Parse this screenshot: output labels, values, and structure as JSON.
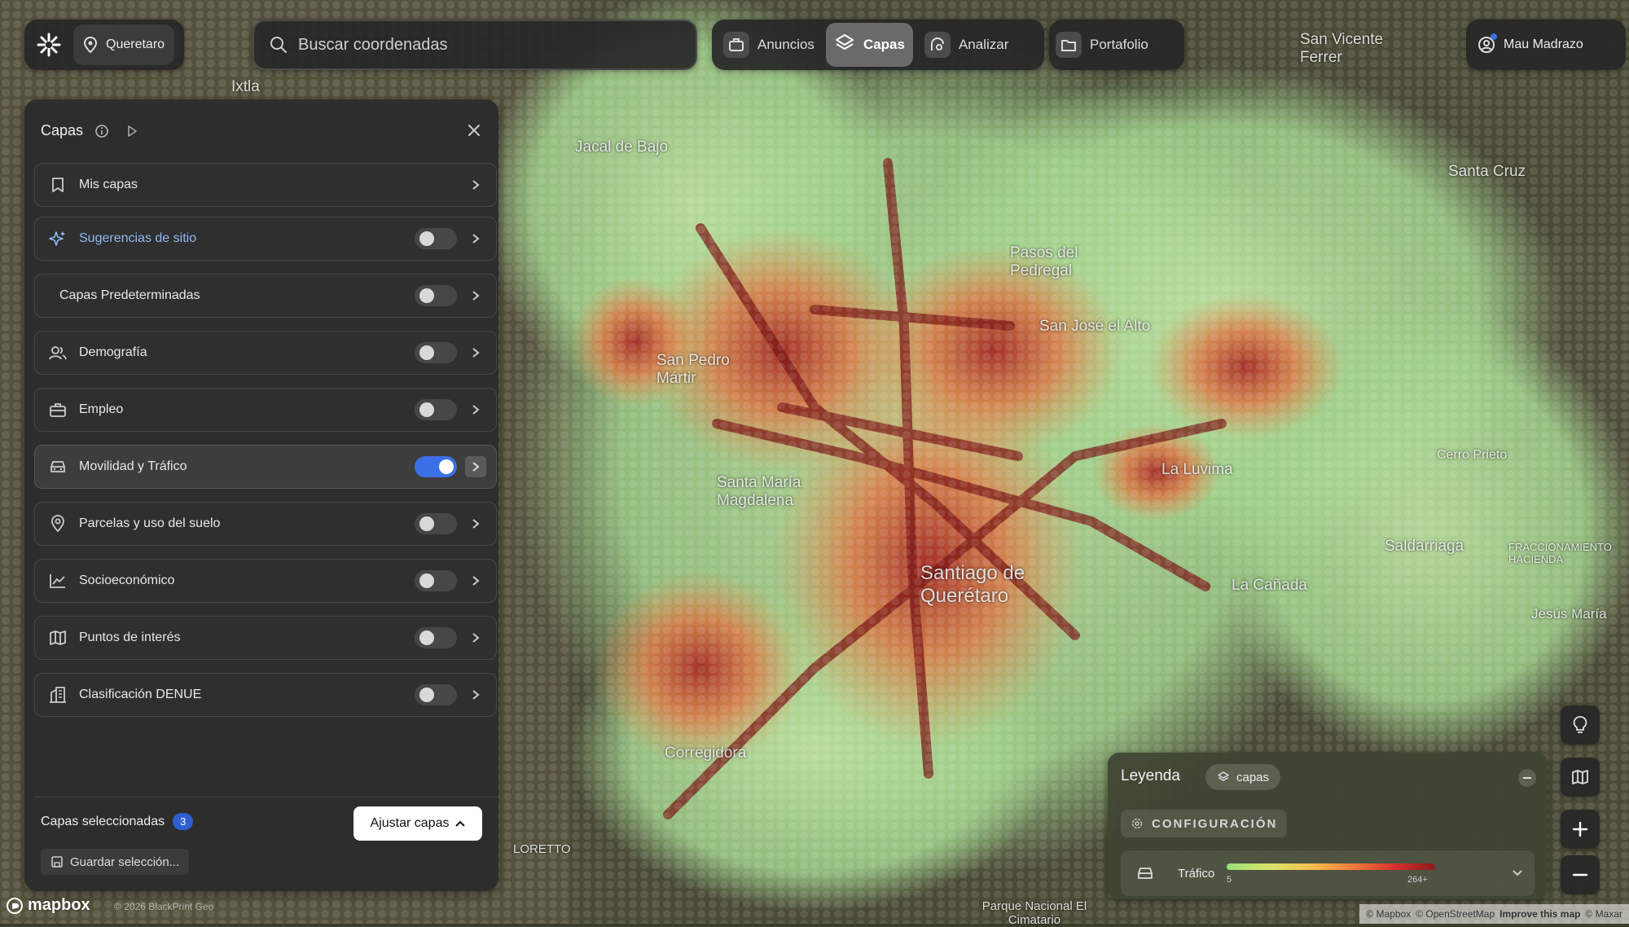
{
  "header": {
    "location": "Queretaro",
    "search_placeholder": "Buscar coordenadas",
    "nav": [
      "Anuncios",
      "Capas",
      "Analizar"
    ],
    "portfolio": "Portafolio",
    "user": "Mau Madrazo"
  },
  "panel": {
    "title": "Capas",
    "rows": [
      {
        "label": "Mis capas",
        "icon": "bookmark-icon"
      },
      {
        "label": "Sugerencias de sitio",
        "icon": "sparkle-icon"
      },
      {
        "label": "Capas Predeterminadas",
        "icon": ""
      },
      {
        "label": "Demografía",
        "icon": "users-icon"
      },
      {
        "label": "Empleo",
        "icon": "briefcase-icon"
      },
      {
        "label": "Movilidad y Tráfico",
        "icon": "car-icon"
      },
      {
        "label": "Parcelas y uso del suelo",
        "icon": "pin-icon"
      },
      {
        "label": "Socioeconómico",
        "icon": "chart-line-icon"
      },
      {
        "label": "Puntos de interés",
        "icon": "map-icon"
      },
      {
        "label": "Clasificación DENUE",
        "icon": "building-icon"
      }
    ],
    "selected_label": "Capas seleccionadas",
    "selected_count": "3",
    "adjust_label": "Ajustar capas",
    "save_label": "Guardar selección..."
  },
  "legend": {
    "title": "Leyenda",
    "chip": "capas",
    "config": "CONFIGURACIÓN",
    "layer": "Tráfico",
    "min": "5",
    "max": "264+"
  },
  "map_labels": {
    "ixtla": "Ixtla",
    "jacal": "Jacal de Bajo",
    "pasos": "Pasos del Pedregal",
    "sanjose": "San José el Alto",
    "sanvicente": "San Vicente Ferrer",
    "santacruz": "Santa Cruz",
    "sanpedro": "San Pedro Mártir",
    "santamaria": "Santa María Magdalena",
    "lauvima": "La Luvima",
    "santiago": "Santiago de Querétaro",
    "lacanada": "La Cañada",
    "saldarriaga": "Saldarriaga",
    "corregidora": "Corregidora",
    "loretto": "LORETTO",
    "parque": "Parque Nacional El Cimatario",
    "cerro": "Cerro Prieto",
    "jesusmaria": "Jesús María",
    "hacienda": "FRACCIONAMIENTO HACIENDA"
  },
  "footer": {
    "mapbox": "mapbox",
    "copyright": "© 2026 BlackPrint Geo",
    "attribution": [
      "© Mapbox",
      "© OpenStreetMap",
      "Improve this map",
      "© Maxar"
    ]
  },
  "colors": {
    "accent": "#3b6fe6",
    "panel_bg": "#2d2d2d",
    "traffic_low": "#9be07a",
    "traffic_high": "#8b1b1b"
  }
}
